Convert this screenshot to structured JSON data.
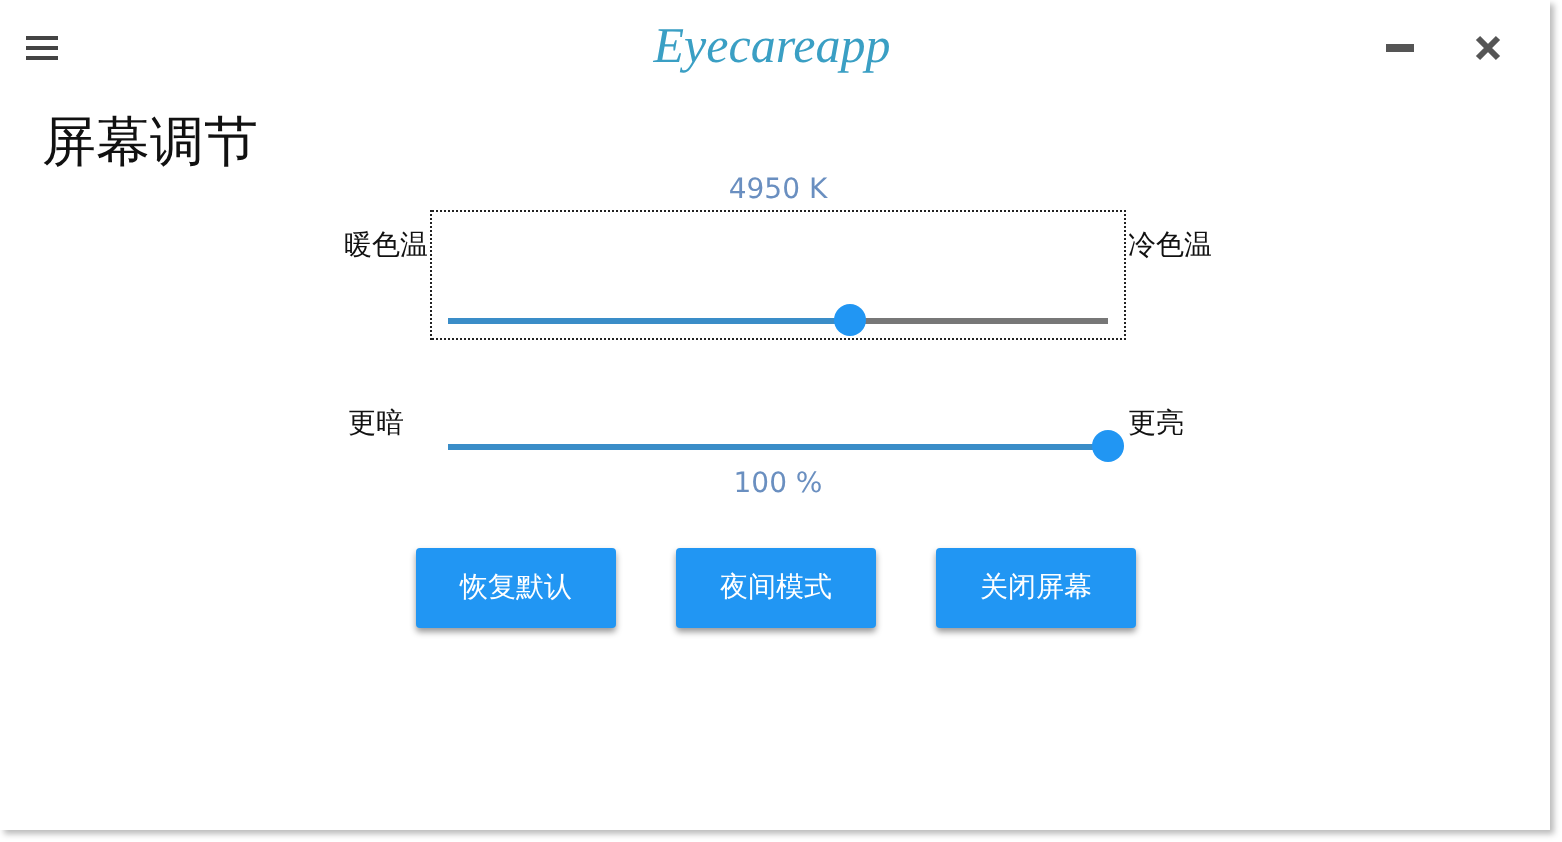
{
  "header": {
    "logo": "Eyecareapp"
  },
  "title": "屏幕调节",
  "sliders": [
    {
      "left_label": "暖色温",
      "right_label": "冷色温",
      "reading": "4950 K",
      "kind": "reading-above",
      "level": 0.61,
      "focused": true
    },
    {
      "left_label": "更暗",
      "right_label": "更亮",
      "reading": "100 %",
      "kind": "reading-below",
      "level": 1,
      "focused": false
    }
  ],
  "buttons": [
    "恢复默认",
    "夜间模式",
    "关闭屏幕"
  ]
}
